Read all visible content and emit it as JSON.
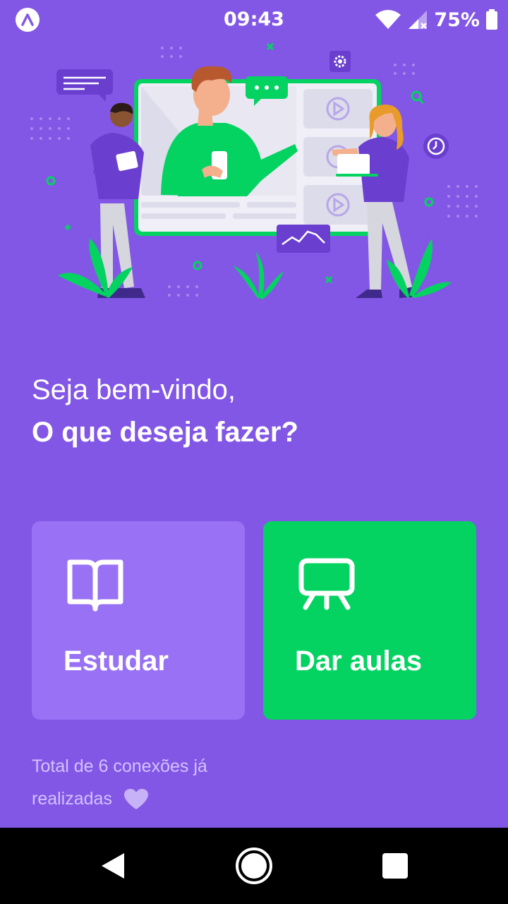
{
  "status_bar": {
    "time": "09:43",
    "battery": "75%",
    "icons": [
      "app-badge-icon",
      "wifi-icon",
      "cell-signal-icon",
      "battery-icon"
    ]
  },
  "hero": {
    "illustration": "online-classes-illustration"
  },
  "greeting": {
    "line1": "Seja bem-vindo,",
    "line2": "O que deseja fazer?"
  },
  "actions": {
    "study": {
      "label": "Estudar",
      "icon": "book-open-icon",
      "color": "#9871F5"
    },
    "teach": {
      "label": "Dar aulas",
      "icon": "presentation-board-icon",
      "color": "#04D361"
    }
  },
  "footer": {
    "connections_text": "Total de 6 conexões já realizadas",
    "icon": "heart-icon"
  },
  "nav_bar": {
    "icons": [
      "back-triangle-icon",
      "home-circle-icon",
      "recents-square-icon"
    ]
  },
  "colors": {
    "background": "#8257E5",
    "accent_green": "#04D361",
    "card_purple": "#9871F5",
    "muted_text": "#D4C2FF"
  }
}
